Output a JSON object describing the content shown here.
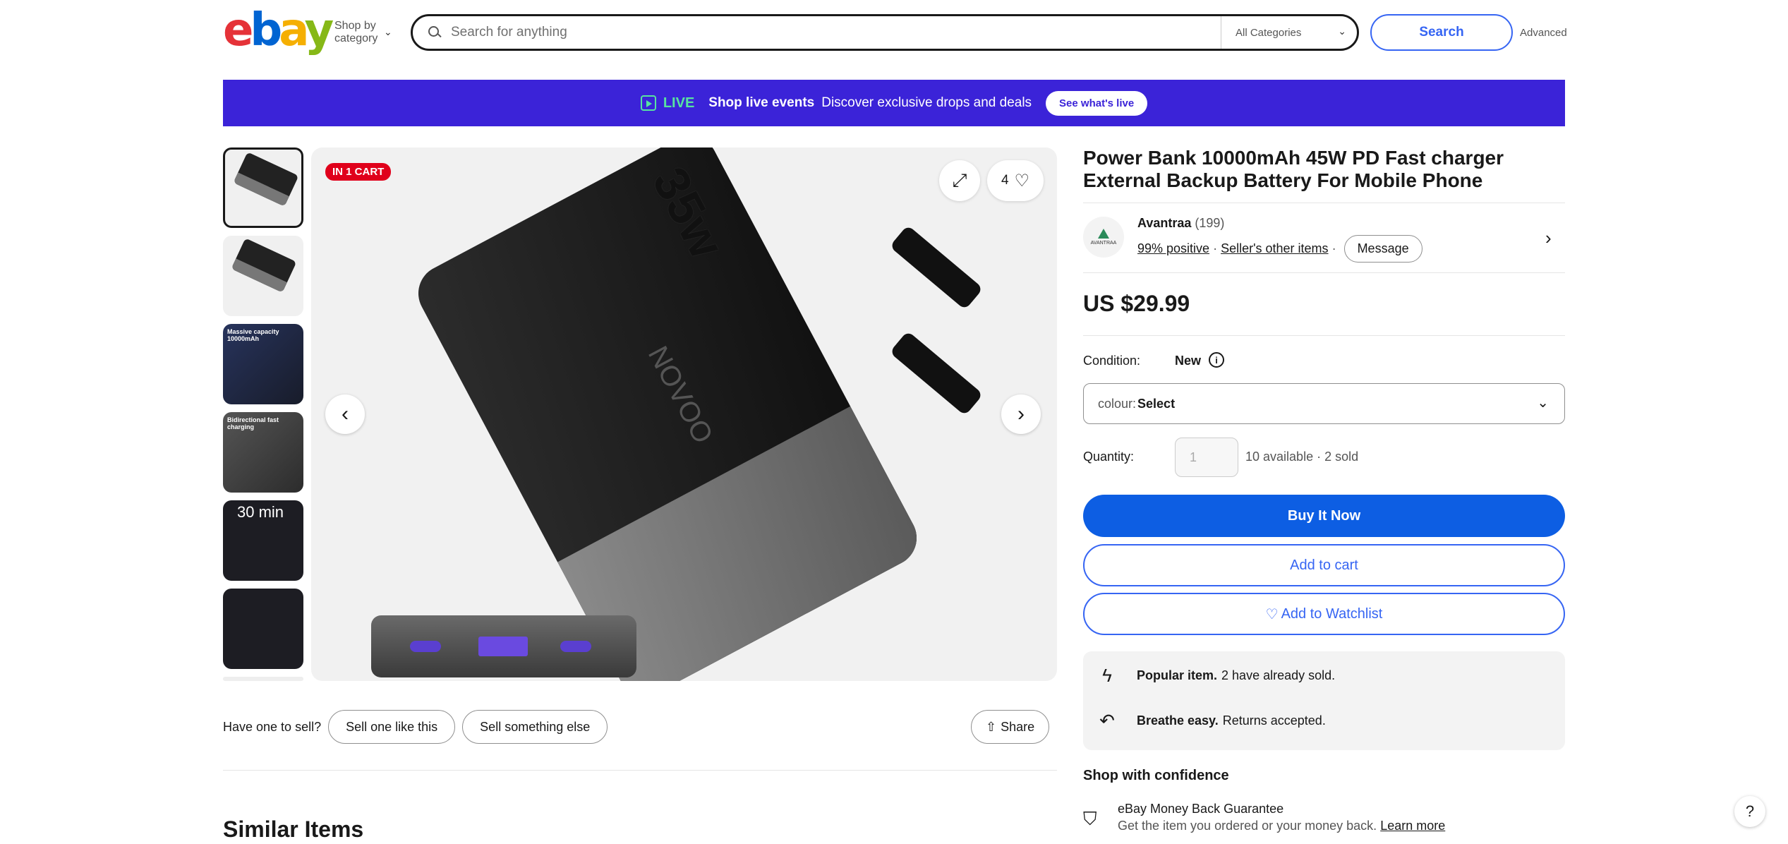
{
  "header": {
    "logo_letters": [
      "e",
      "b",
      "a",
      "y"
    ],
    "shop_by_category": "Shop by category",
    "search_placeholder": "Search for anything",
    "category_select": "All Categories",
    "search_button": "Search",
    "advanced": "Advanced"
  },
  "banner": {
    "live": "LIVE",
    "events": "Shop live events",
    "description": "Discover exclusive drops and deals",
    "cta": "See what's live"
  },
  "gallery": {
    "badge": "IN 1 CART",
    "watch_count": "4",
    "thumbnails": [
      {
        "caption": ""
      },
      {
        "caption": ""
      },
      {
        "caption": "Massive capacity 10000mAh"
      },
      {
        "caption": "Bidirectional fast charging"
      },
      {
        "caption": "30 min"
      },
      {
        "caption": ""
      }
    ]
  },
  "product_image": {
    "brand_text": "NOVOO",
    "wattage": "35w"
  },
  "sell": {
    "prompt": "Have one to sell?",
    "sell_one": "Sell one like this",
    "sell_else": "Sell something else",
    "share": "Share"
  },
  "similar_items": "Similar Items",
  "product": {
    "title": "Power Bank 10000mAh 45W PD Fast charger External Backup Battery For Mobile Phone",
    "seller": {
      "name": "Avantraa",
      "feedback_count": "(199)",
      "positive": "99% positive",
      "other_items": "Seller's other items",
      "message": "Message",
      "logo_text": "AVANTRAA"
    },
    "price": "US $29.99",
    "condition_label": "Condition:",
    "condition_value": "New",
    "colour_label": "colour:",
    "colour_value": "Select",
    "quantity_label": "Quantity:",
    "quantity_value": "1",
    "availability": "10 available · 2 sold",
    "buy_now": "Buy It Now",
    "add_to_cart": "Add to cart",
    "add_to_watchlist": "Add to Watchlist",
    "popular_bold": "Popular item.",
    "popular_text": "2 have already sold.",
    "returns_bold": "Breathe easy.",
    "returns_text": "Returns accepted.",
    "confidence_title": "Shop with confidence",
    "guarantee_title": "eBay Money Back Guarantee",
    "guarantee_text": "Get the item you ordered or your money back.",
    "learn_more": "Learn more"
  },
  "help": "?"
}
